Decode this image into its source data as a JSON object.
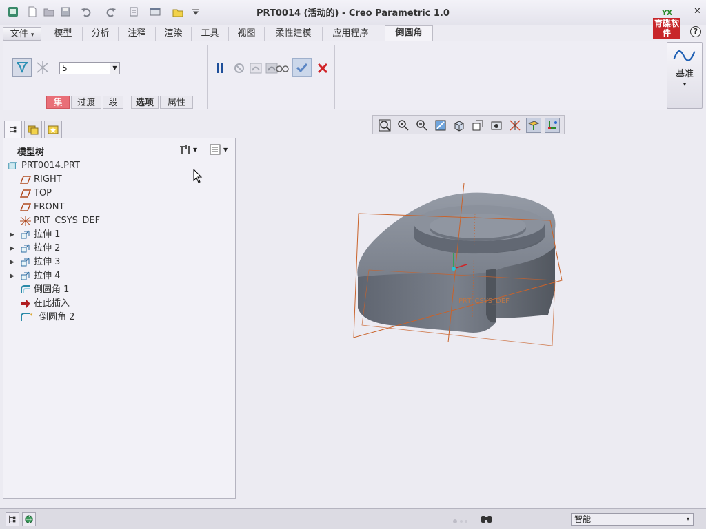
{
  "window": {
    "title": "PRT0014 (活动的) - Creo Parametric 1.0",
    "logo_top_text": "YX",
    "logo_text": "育碟软件"
  },
  "quick_access": [
    {
      "icon": "app-icon"
    },
    {
      "icon": "new-file-icon"
    },
    {
      "icon": "open-icon"
    },
    {
      "icon": "save-icon"
    },
    {
      "icon": "undo-icon"
    },
    {
      "icon": "redo-icon"
    },
    {
      "icon": "regenerate-icon"
    },
    {
      "icon": "windows-icon"
    },
    {
      "icon": "close-window-icon"
    },
    {
      "icon": "customize-icon"
    }
  ],
  "ribbon": {
    "tabs": [
      {
        "label": "文件",
        "caret": "▾"
      },
      {
        "label": "模型"
      },
      {
        "label": "分析"
      },
      {
        "label": "注释"
      },
      {
        "label": "渲染"
      },
      {
        "label": "工具"
      },
      {
        "label": "视图"
      },
      {
        "label": "柔性建模"
      },
      {
        "label": "应用程序"
      },
      {
        "label": "倒圆角"
      }
    ],
    "round": {
      "radius_value": "5",
      "subtabs": [
        "集",
        "过渡",
        "段",
        "选项",
        "属性"
      ]
    },
    "datum": {
      "label": "基准",
      "caret": "▾"
    }
  },
  "model_tree": {
    "title": "模型树",
    "items": [
      {
        "label": "PRT0014.PRT",
        "icon": "part-icon",
        "expandable": false,
        "indent": 0
      },
      {
        "label": "RIGHT",
        "icon": "datum-plane-icon",
        "expandable": false,
        "indent": 1
      },
      {
        "label": "TOP",
        "icon": "datum-plane-icon",
        "expandable": false,
        "indent": 1
      },
      {
        "label": "FRONT",
        "icon": "datum-plane-icon",
        "expandable": false,
        "indent": 1
      },
      {
        "label": "PRT_CSYS_DEF",
        "icon": "csys-icon",
        "expandable": false,
        "indent": 1
      },
      {
        "label": "拉伸 1",
        "icon": "extrude-icon",
        "expandable": true,
        "indent": 1
      },
      {
        "label": "拉伸 2",
        "icon": "extrude-icon",
        "expandable": true,
        "indent": 1
      },
      {
        "label": "拉伸 3",
        "icon": "extrude-icon",
        "expandable": true,
        "indent": 1
      },
      {
        "label": "拉伸 4",
        "icon": "extrude-icon",
        "expandable": true,
        "indent": 1
      },
      {
        "label": "倒圆角 1",
        "icon": "round-icon",
        "expandable": false,
        "indent": 1
      },
      {
        "label": "在此插入",
        "icon": "insert-here-icon",
        "expandable": false,
        "indent": 1
      },
      {
        "label": "倒圆角 2",
        "icon": "round-new-icon",
        "expandable": false,
        "indent": 1
      }
    ]
  },
  "viewport": {
    "csys_label": "PRT_CSYS_DEF"
  },
  "statusbar": {
    "filter_value": "智能",
    "filter_caret": "▾"
  },
  "colors": {
    "accent_red": "#e96f78",
    "datum_orange": "#c9622a",
    "model_gray": "#6e7480"
  }
}
